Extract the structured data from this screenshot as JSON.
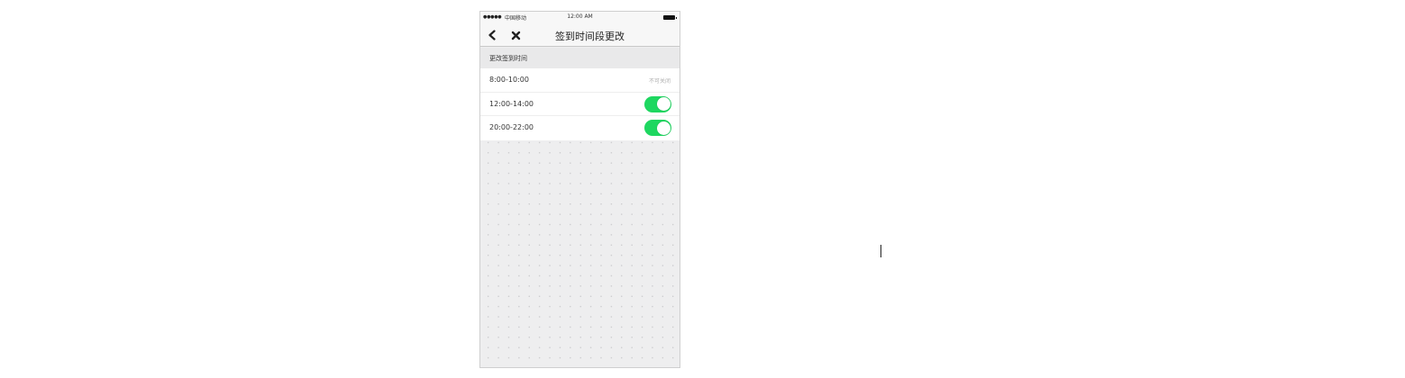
{
  "status_bar": {
    "signal": "●●●●●",
    "carrier": "中国移动",
    "time": "12:00 AM"
  },
  "nav": {
    "title": "签到时间段更改"
  },
  "section": {
    "header": "更改签到时间"
  },
  "time_slots": [
    {
      "label": "8:00-10:00",
      "note": "不可关闭"
    },
    {
      "label": "12:00-14:00",
      "toggle_on": true
    },
    {
      "label": "20:00-22:00",
      "toggle_on": true
    }
  ],
  "colors": {
    "toggle_on": "#1ed760",
    "background": "#eeeeef"
  }
}
